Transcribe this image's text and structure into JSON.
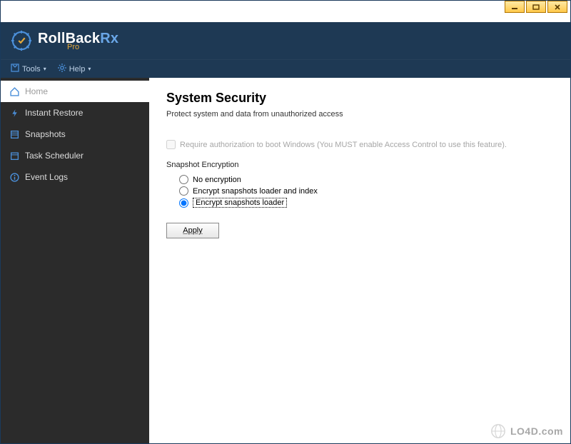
{
  "brand": {
    "name_a": "RollBack",
    "name_b": "Rx",
    "sub": "Pro"
  },
  "menubar": {
    "tools": "Tools",
    "help": "Help"
  },
  "sidebar": {
    "items": [
      {
        "label": "Home"
      },
      {
        "label": "Instant Restore"
      },
      {
        "label": "Snapshots"
      },
      {
        "label": "Task Scheduler"
      },
      {
        "label": "Event Logs"
      }
    ]
  },
  "page": {
    "title": "System Security",
    "subtitle": "Protect system and data from unauthorized access",
    "require_auth_label": "Require authorization to boot Windows (You MUST enable Access Control to use this feature).",
    "encryption_section": "Snapshot Encryption",
    "radio": {
      "none": "No encryption",
      "loader_index": "Encrypt snapshots loader and index",
      "loader": "Encrypt snapshots loader"
    },
    "selected_radio": "loader",
    "apply": "Apply"
  },
  "watermark": "LO4D.com"
}
